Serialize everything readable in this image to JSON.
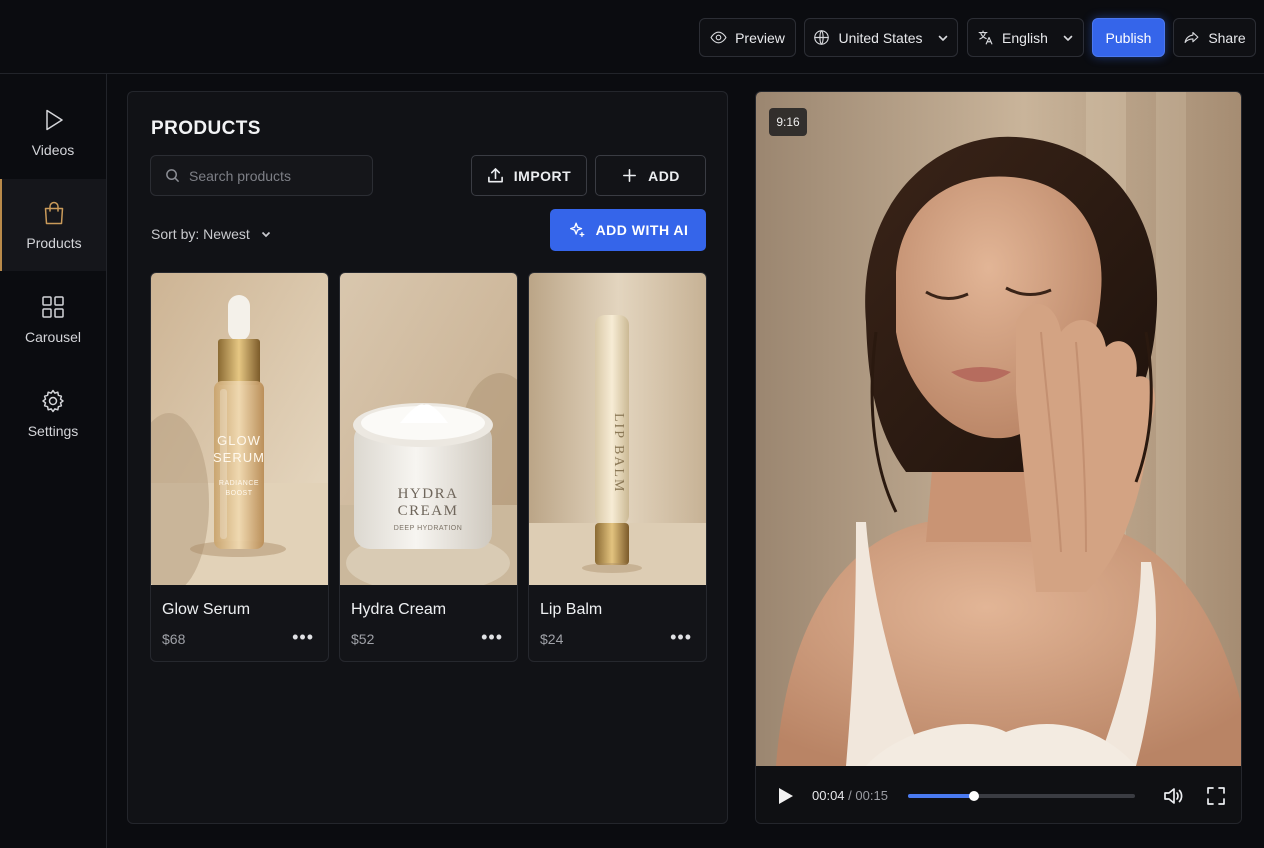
{
  "topbar": {
    "preview_label": "Preview",
    "country_label": "United States",
    "language_label": "English",
    "publish_label": "Publish",
    "share_label": "Share"
  },
  "sidebar": {
    "items": [
      {
        "label": "Videos",
        "icon": "play-icon",
        "active": false
      },
      {
        "label": "Products",
        "icon": "shopping-bag-icon",
        "active": true
      },
      {
        "label": "Carousel",
        "icon": "grid-icon",
        "active": false
      },
      {
        "label": "Settings",
        "icon": "gear-icon",
        "active": false
      }
    ]
  },
  "products_panel": {
    "title": "PRODUCTS",
    "search_placeholder": "Search products",
    "import_label": "IMPORT",
    "add_label": "ADD",
    "add_ai_label": "ADD WITH AI",
    "sort_label": "Sort by: Newest",
    "products": [
      {
        "name": "Glow Serum",
        "price": "$68",
        "pack_text": [
          "GLOW",
          "SERUM",
          "RADIANCE",
          "BOOST"
        ]
      },
      {
        "name": "Hydra Cream",
        "price": "$52",
        "pack_text": [
          "HYDRA",
          "CREAM",
          "DEEP HYDRATION"
        ]
      },
      {
        "name": "Lip Balm",
        "price": "$24",
        "pack_text": [
          "LIP BALM"
        ]
      }
    ],
    "more_glyph": "•••"
  },
  "video_player": {
    "aspect_badge": "9:16",
    "current_time": "00:04",
    "separator": "/",
    "duration": "00:15",
    "progress_fraction": 0.29
  },
  "colors": {
    "accent_blue": "#3565ea",
    "active_gold": "#b98a4a",
    "background": "#0b0c10"
  }
}
